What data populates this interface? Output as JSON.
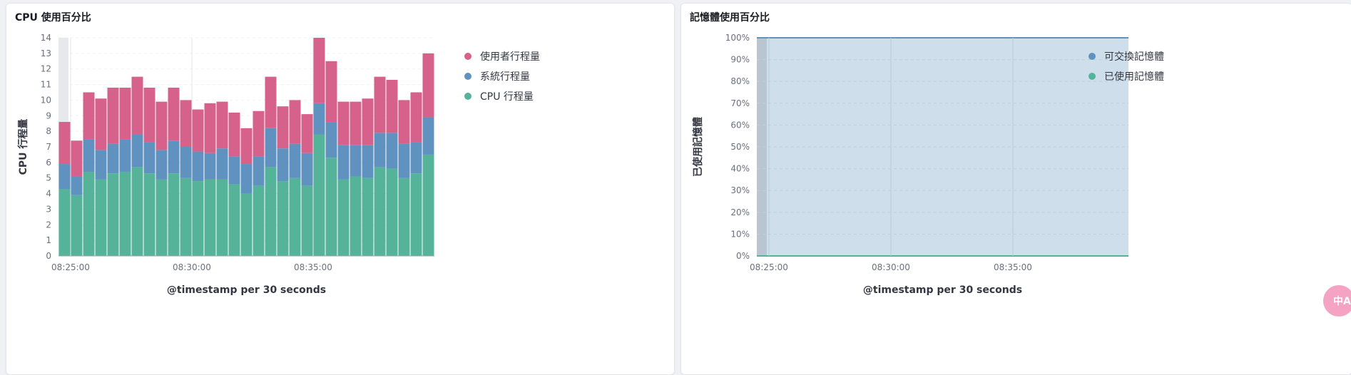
{
  "panels": {
    "cpu": {
      "title": "CPU 使用百分比"
    },
    "memory": {
      "title": "記憶體使用百分比"
    }
  },
  "widget": {
    "label": "中A",
    "icon": "translate-icon"
  },
  "colors": {
    "user": "#d6618a",
    "system": "#6092c0",
    "total": "#54b399",
    "swap": "#6092c0",
    "used_memory": "#54b399",
    "memory_fill": "#cfdeeb"
  },
  "chart_data": [
    {
      "type": "bar",
      "stacked": true,
      "x": [
        "08:24:30",
        "08:25:00",
        "08:25:30",
        "08:26:00",
        "08:26:30",
        "08:27:00",
        "08:27:30",
        "08:28:00",
        "08:28:30",
        "08:29:00",
        "08:29:30",
        "08:30:00",
        "08:30:30",
        "08:31:00",
        "08:31:30",
        "08:32:00",
        "08:32:30",
        "08:33:00",
        "08:33:30",
        "08:34:00",
        "08:34:30",
        "08:35:00",
        "08:35:30",
        "08:36:00",
        "08:36:30",
        "08:37:00",
        "08:37:30",
        "08:38:00",
        "08:38:30",
        "08:39:00",
        "08:39:30",
        "08:40:00"
      ],
      "xticks": [
        "08:25:00",
        "08:30:00",
        "08:35:00"
      ],
      "series": [
        {
          "name": "CPU 行程量",
          "values": [
            4.3,
            3.9,
            5.4,
            4.9,
            5.3,
            5.4,
            5.7,
            5.3,
            4.9,
            5.3,
            5.0,
            4.8,
            4.9,
            4.9,
            4.6,
            4.0,
            4.5,
            5.7,
            4.8,
            5.0,
            4.5,
            7.8,
            6.3,
            4.9,
            5.1,
            5.0,
            5.7,
            5.6,
            5.0,
            5.3,
            6.5
          ]
        },
        {
          "name": "系統行程量",
          "values": [
            1.6,
            1.2,
            2.1,
            1.9,
            1.9,
            2.1,
            2.1,
            2.0,
            1.9,
            2.1,
            2.0,
            1.9,
            1.7,
            2.0,
            1.8,
            1.9,
            1.9,
            2.5,
            2.1,
            2.2,
            2.1,
            2.0,
            2.3,
            2.2,
            2.0,
            2.1,
            2.2,
            2.3,
            2.2,
            2.0,
            2.4
          ]
        },
        {
          "name": "使用者行程量",
          "values": [
            2.7,
            2.3,
            3.0,
            3.3,
            3.6,
            3.3,
            3.7,
            3.5,
            3.1,
            3.4,
            3.0,
            2.7,
            3.2,
            3.0,
            2.8,
            2.3,
            2.9,
            3.3,
            2.7,
            2.8,
            2.5,
            4.2,
            3.9,
            2.8,
            2.8,
            3.0,
            3.6,
            3.4,
            2.8,
            3.2,
            4.1
          ]
        }
      ],
      "xlabel": "@timestamp per 30 seconds",
      "ylabel": "CPU 行程量",
      "ylim": [
        0,
        14
      ],
      "yticks": [
        0,
        1,
        2,
        3,
        4,
        5,
        6,
        7,
        8,
        9,
        10,
        11,
        12,
        13,
        14
      ],
      "grid": true,
      "legend": "right"
    },
    {
      "type": "area",
      "stacked": true,
      "xticks": [
        "08:25:00",
        "08:30:00",
        "08:35:00"
      ],
      "series": [
        {
          "name": "可交換記憶體",
          "values": [
            100,
            100,
            100,
            100,
            100
          ]
        },
        {
          "name": "已使用記憶體",
          "values": [
            0,
            0,
            0,
            0,
            0
          ]
        }
      ],
      "xlabel": "@timestamp per 30 seconds",
      "ylabel": "已使用記憶體",
      "ylim": [
        0,
        100
      ],
      "yticks": [
        "0%",
        "10%",
        "20%",
        "30%",
        "40%",
        "50%",
        "60%",
        "70%",
        "80%",
        "90%",
        "100%"
      ],
      "grid": true,
      "legend": "right"
    }
  ]
}
